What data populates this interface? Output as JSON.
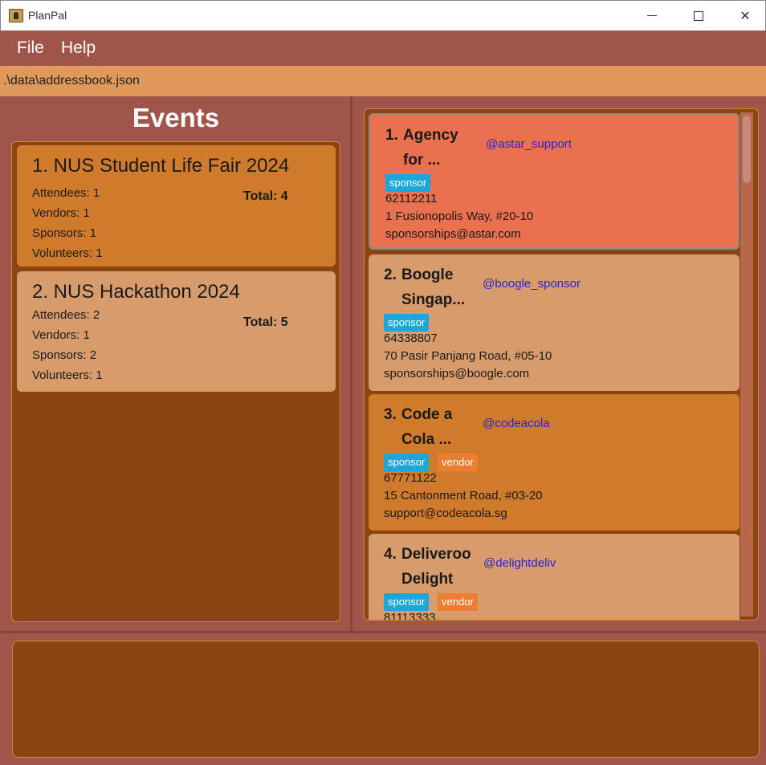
{
  "window": {
    "title": "PlanPal"
  },
  "menu": {
    "file": "File",
    "help": "Help"
  },
  "status_path": ".\\data\\addressbook.json",
  "events": {
    "heading": "Events",
    "items": [
      {
        "title": "1. NUS Student Life Fair 2024",
        "attendees": "Attendees: 1",
        "vendors": "Vendors: 1",
        "sponsors": "Sponsors: 1",
        "volunteers": "Volunteers: 1",
        "total": "Total: 4",
        "selected": true
      },
      {
        "title": "2. NUS Hackathon 2024",
        "attendees": "Attendees: 2",
        "vendors": "Vendors: 1",
        "sponsors": "Sponsors: 2",
        "volunteers": "Volunteers: 1",
        "total": "Total: 5",
        "selected": false
      }
    ]
  },
  "contacts": [
    {
      "num": "1.",
      "name_line1": "Agency",
      "name_line2": "for ...",
      "handle": "@astar_support",
      "tags": [
        "sponsor"
      ],
      "phone": "62112211",
      "address": "1 Fusionopolis Way, #20-10",
      "email": "sponsorships@astar.com"
    },
    {
      "num": "2.",
      "name_line1": "Boogle",
      "name_line2": "Singap...",
      "handle": "@boogle_sponsor",
      "tags": [
        "sponsor"
      ],
      "phone": "64338807",
      "address": "70 Pasir Panjang Road, #05-10",
      "email": "sponsorships@boogle.com"
    },
    {
      "num": "3.",
      "name_line1": "Code a",
      "name_line2": "Cola ...",
      "handle": "@codeacola",
      "tags": [
        "sponsor",
        "vendor"
      ],
      "phone": "67771122",
      "address": "15 Cantonment Road, #03-20",
      "email": "support@codeacola.sg"
    },
    {
      "num": "4.",
      "name_line1": "Deliveroo",
      "name_line2": "Delight",
      "handle": "@delightdeliv",
      "tags": [
        "sponsor",
        "vendor"
      ],
      "phone": "81113333",
      "address": "",
      "email": ""
    }
  ],
  "result_display": "",
  "colors": {
    "background": "#a0554a",
    "path_bar": "#de995b",
    "panel": "#8b4512",
    "card_selected_event": "#d07b2c",
    "card_normal": "#d89c6c",
    "card_selected_contact": "#e97150",
    "tag_sponsor": "#1fa6d8",
    "tag_vendor": "#ed7d31",
    "handle": "#2a20d8"
  }
}
